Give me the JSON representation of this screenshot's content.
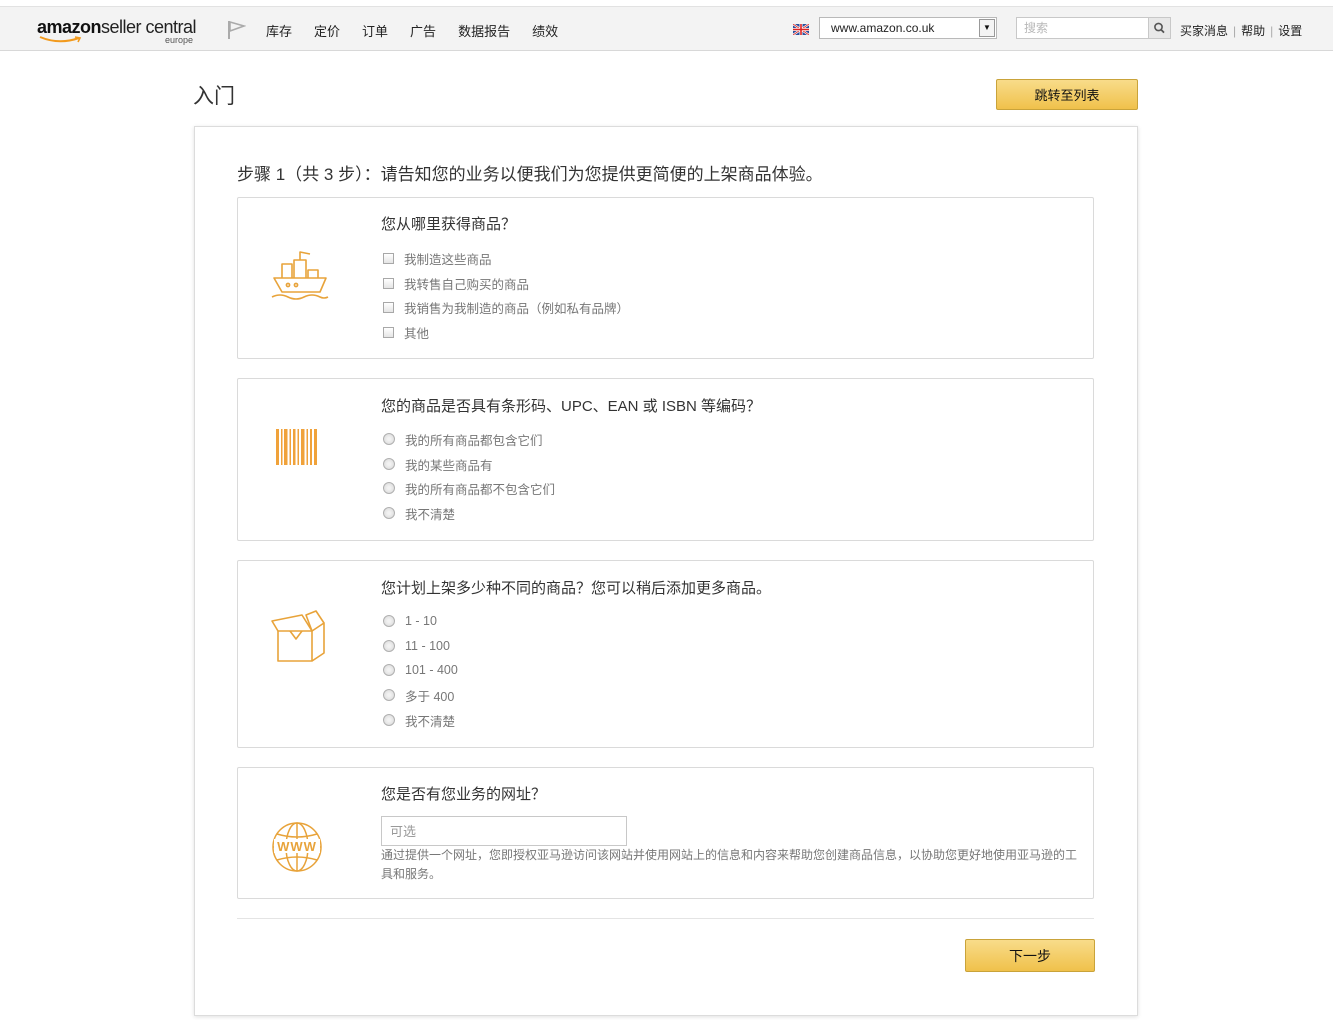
{
  "header": {
    "logo_amazon": "amazon",
    "logo_seller": "seller central",
    "logo_region": "europe",
    "nav": [
      "库存",
      "定价",
      "订单",
      "广告",
      "数据报告",
      "绩效"
    ],
    "marketplace": "www.amazon.co.uk",
    "search_placeholder": "搜索",
    "links": [
      "买家消息",
      "帮助",
      "设置"
    ]
  },
  "page": {
    "title": "入门",
    "jump_label": "跳转至列表",
    "step_title": "步骤 1（共 3 步）：请告知您的业务以便我们为您提供更简便的上架商品体验。",
    "next_label": "下一步"
  },
  "questions": [
    {
      "title": "您从哪里获得商品？",
      "icon": "ship-icon",
      "input": "checkbox",
      "options": [
        "我制造这些商品",
        "我转售自己购买的商品",
        "我销售为我制造的商品（例如私有品牌）",
        "其他"
      ]
    },
    {
      "title": "您的商品是否具有条形码、UPC、EAN 或 ISBN 等编码？",
      "icon": "barcode-icon",
      "input": "radio",
      "options": [
        "我的所有商品都包含它们",
        "我的某些商品有",
        "我的所有商品都不包含它们",
        "我不清楚"
      ]
    },
    {
      "title": "您计划上架多少种不同的商品？您可以稍后添加更多商品。",
      "icon": "box-icon",
      "input": "radio",
      "options": [
        "1 - 10",
        "11 - 100",
        "101 - 400",
        "多于 400",
        "我不清楚"
      ]
    },
    {
      "title": "您是否有您业务的网址？",
      "icon": "www-globe-icon",
      "input": "text",
      "placeholder": "可选",
      "help": "通过提供一个网址，您即授权亚马逊访问该网站并使用网站上的信息和内容来帮助您创建商品信息，以协助您更好地使用亚马逊的工具和服务。"
    }
  ],
  "colors": {
    "accent": "#f0c14b",
    "icon": "#e8a33a",
    "button_border": "#c9a33a"
  }
}
